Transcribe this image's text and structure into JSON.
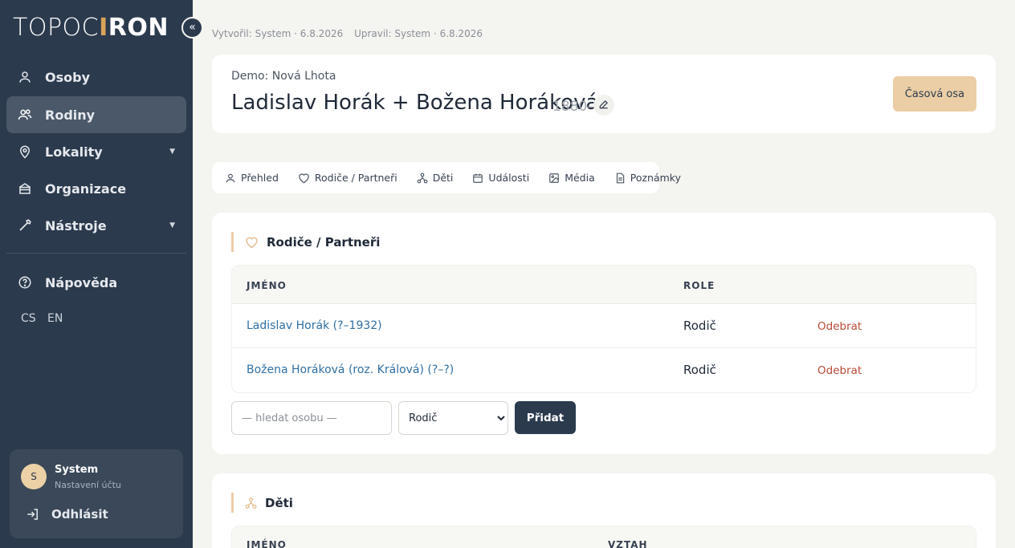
{
  "sidebar": {
    "logo_left": "TOPOC",
    "logo_accent": "I",
    "logo_right": "RON",
    "collapse_icon": "double-chevron-left-icon",
    "nav": [
      {
        "label": "Osoby",
        "icon": "user-icon"
      },
      {
        "label": "Rodiny",
        "icon": "users-icon",
        "active": true
      },
      {
        "label": "Lokality",
        "icon": "map-pin-icon",
        "has_submenu": true
      },
      {
        "label": "Organizace",
        "icon": "building-icon"
      },
      {
        "label": "Nástroje",
        "icon": "tools-icon",
        "has_submenu": true
      },
      {
        "label": "Nápověda",
        "icon": "help-icon"
      }
    ],
    "languages": [
      "CS",
      "EN"
    ],
    "user": {
      "initial": "S",
      "name": "System",
      "subtitle": "Nastavení účtu",
      "logout": "Odhlásit"
    }
  },
  "meta": {
    "created": "Vytvořil: System · 6.8.2026",
    "updated": "Upravil: System · 6.8.2026"
  },
  "header": {
    "org": "Demo: Nová Lhota",
    "title": "Ladislav Horák + Božena Horáková",
    "years": "1880–",
    "timeline_button": "Časová osa"
  },
  "tabs": [
    {
      "label": "Přehled",
      "icon": "user-icon"
    },
    {
      "label": "Rodiče / Partneři",
      "icon": "heart-icon"
    },
    {
      "label": "Děti",
      "icon": "family-tree-icon"
    },
    {
      "label": "Události",
      "icon": "calendar-icon"
    },
    {
      "label": "Média",
      "icon": "image-icon"
    },
    {
      "label": "Poznámky",
      "icon": "note-icon"
    }
  ],
  "parents": {
    "title": "Rodiče / Partneři",
    "columns": {
      "name": "JMÉNO",
      "role": "ROLE"
    },
    "rows": [
      {
        "name": "Ladislav Horák (?–1932)",
        "role": "Rodič",
        "action": "Odebrat"
      },
      {
        "name": "Božena Horáková (roz. Králová) (?–?)",
        "role": "Rodič",
        "action": "Odebrat"
      }
    ],
    "search_placeholder": "— hledat osobu —",
    "role_selected": "Rodič",
    "add_button": "Přidat"
  },
  "children": {
    "title": "Děti",
    "columns": {
      "name": "JMÉNO",
      "relation": "VZTAH"
    }
  },
  "colors": {
    "sidebar": "#2b3a4d",
    "accent": "#ebcea5",
    "link": "#2f6fa3",
    "danger": "#b94a36"
  }
}
